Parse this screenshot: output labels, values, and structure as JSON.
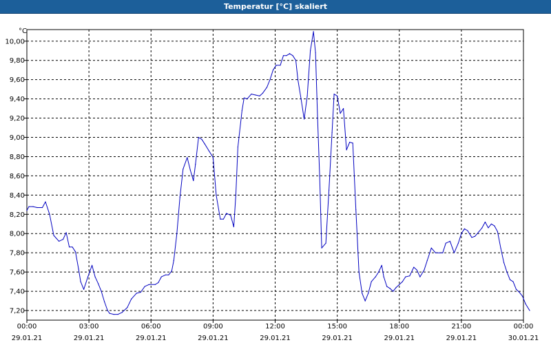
{
  "window": {
    "title": "Temperatur [°C] skaliert"
  },
  "chart_data": {
    "type": "line",
    "unit_label": "°C",
    "ylim": [
      7.1,
      10.12
    ],
    "xlim": [
      "29.01.21 00:00",
      "30.01.21 00:00"
    ],
    "grid": true,
    "y_ticks": [
      "10,00",
      "9,80",
      "9,60",
      "9,40",
      "9,20",
      "9,00",
      "8,80",
      "8,60",
      "8,40",
      "8,20",
      "8,00",
      "7,80",
      "7,60",
      "7,40",
      "7,20"
    ],
    "y_tick_values": [
      10.0,
      9.8,
      9.6,
      9.4,
      9.2,
      9.0,
      8.8,
      8.6,
      8.4,
      8.2,
      8.0,
      7.8,
      7.6,
      7.4,
      7.2
    ],
    "x_ticks": [
      {
        "time": "00:00",
        "date": "29.01.21",
        "hour": 0
      },
      {
        "time": "03:00",
        "date": "29.01.21",
        "hour": 3
      },
      {
        "time": "06:00",
        "date": "29.01.21",
        "hour": 6
      },
      {
        "time": "09:00",
        "date": "29.01.21",
        "hour": 9
      },
      {
        "time": "12:00",
        "date": "29.01.21",
        "hour": 12
      },
      {
        "time": "15:00",
        "date": "29.01.21",
        "hour": 15
      },
      {
        "time": "18:00",
        "date": "29.01.21",
        "hour": 18
      },
      {
        "time": "21:00",
        "date": "29.01.21",
        "hour": 21
      },
      {
        "time": "00:00",
        "date": "30.01.21",
        "hour": 24
      }
    ],
    "series": [
      {
        "color": "#0000c0",
        "points": [
          [
            0.0,
            8.24
          ],
          [
            0.1,
            8.28
          ],
          [
            0.3,
            8.28
          ],
          [
            0.5,
            8.27
          ],
          [
            0.75,
            8.27
          ],
          [
            0.9,
            8.33
          ],
          [
            1.1,
            8.2
          ],
          [
            1.3,
            7.98
          ],
          [
            1.55,
            7.92
          ],
          [
            1.75,
            7.94
          ],
          [
            1.9,
            8.01
          ],
          [
            2.05,
            7.86
          ],
          [
            2.2,
            7.86
          ],
          [
            2.35,
            7.81
          ],
          [
            2.5,
            7.63
          ],
          [
            2.6,
            7.5
          ],
          [
            2.75,
            7.42
          ],
          [
            2.95,
            7.55
          ],
          [
            3.15,
            7.67
          ],
          [
            3.3,
            7.55
          ],
          [
            3.45,
            7.48
          ],
          [
            3.6,
            7.4
          ],
          [
            3.75,
            7.29
          ],
          [
            3.9,
            7.2
          ],
          [
            4.0,
            7.17
          ],
          [
            4.2,
            7.16
          ],
          [
            4.4,
            7.16
          ],
          [
            4.6,
            7.18
          ],
          [
            4.85,
            7.23
          ],
          [
            5.05,
            7.32
          ],
          [
            5.3,
            7.38
          ],
          [
            5.5,
            7.39
          ],
          [
            5.7,
            7.45
          ],
          [
            5.9,
            7.47
          ],
          [
            6.2,
            7.47
          ],
          [
            6.35,
            7.49
          ],
          [
            6.5,
            7.55
          ],
          [
            6.7,
            7.57
          ],
          [
            6.85,
            7.57
          ],
          [
            7.0,
            7.61
          ],
          [
            7.1,
            7.72
          ],
          [
            7.25,
            8.0
          ],
          [
            7.4,
            8.38
          ],
          [
            7.55,
            8.67
          ],
          [
            7.75,
            8.79
          ],
          [
            7.9,
            8.66
          ],
          [
            8.05,
            8.55
          ],
          [
            8.15,
            8.72
          ],
          [
            8.3,
            9.0
          ],
          [
            8.45,
            8.98
          ],
          [
            8.6,
            8.93
          ],
          [
            8.8,
            8.86
          ],
          [
            9.0,
            8.79
          ],
          [
            9.15,
            8.4
          ],
          [
            9.35,
            8.15
          ],
          [
            9.5,
            8.15
          ],
          [
            9.65,
            8.21
          ],
          [
            9.85,
            8.19
          ],
          [
            10.0,
            8.07
          ],
          [
            10.1,
            8.4
          ],
          [
            10.2,
            8.9
          ],
          [
            10.4,
            9.28
          ],
          [
            10.5,
            9.41
          ],
          [
            10.65,
            9.4
          ],
          [
            10.85,
            9.45
          ],
          [
            11.05,
            9.44
          ],
          [
            11.25,
            9.43
          ],
          [
            11.4,
            9.46
          ],
          [
            11.6,
            9.52
          ],
          [
            11.75,
            9.6
          ],
          [
            11.9,
            9.7
          ],
          [
            12.05,
            9.75
          ],
          [
            12.25,
            9.75
          ],
          [
            12.4,
            9.85
          ],
          [
            12.55,
            9.85
          ],
          [
            12.7,
            9.87
          ],
          [
            12.85,
            9.85
          ],
          [
            13.0,
            9.8
          ],
          [
            13.1,
            9.6
          ],
          [
            13.25,
            9.4
          ],
          [
            13.4,
            9.19
          ],
          [
            13.55,
            9.43
          ],
          [
            13.7,
            9.9
          ],
          [
            13.85,
            10.1
          ],
          [
            13.95,
            9.88
          ],
          [
            14.05,
            9.2
          ],
          [
            14.15,
            8.6
          ],
          [
            14.25,
            7.85
          ],
          [
            14.45,
            7.9
          ],
          [
            14.6,
            8.45
          ],
          [
            14.75,
            9.05
          ],
          [
            14.85,
            9.45
          ],
          [
            15.0,
            9.43
          ],
          [
            15.15,
            9.25
          ],
          [
            15.3,
            9.3
          ],
          [
            15.45,
            8.87
          ],
          [
            15.6,
            8.95
          ],
          [
            15.75,
            8.94
          ],
          [
            15.9,
            8.25
          ],
          [
            16.05,
            7.6
          ],
          [
            16.2,
            7.38
          ],
          [
            16.35,
            7.3
          ],
          [
            16.5,
            7.38
          ],
          [
            16.65,
            7.5
          ],
          [
            16.85,
            7.55
          ],
          [
            17.0,
            7.6
          ],
          [
            17.15,
            7.67
          ],
          [
            17.25,
            7.55
          ],
          [
            17.4,
            7.45
          ],
          [
            17.55,
            7.43
          ],
          [
            17.7,
            7.4
          ],
          [
            17.85,
            7.44
          ],
          [
            18.0,
            7.47
          ],
          [
            18.15,
            7.5
          ],
          [
            18.3,
            7.55
          ],
          [
            18.5,
            7.56
          ],
          [
            18.7,
            7.65
          ],
          [
            18.85,
            7.62
          ],
          [
            19.0,
            7.55
          ],
          [
            19.2,
            7.62
          ],
          [
            19.35,
            7.72
          ],
          [
            19.55,
            7.85
          ],
          [
            19.75,
            7.8
          ],
          [
            19.95,
            7.8
          ],
          [
            20.1,
            7.8
          ],
          [
            20.25,
            7.9
          ],
          [
            20.45,
            7.92
          ],
          [
            20.65,
            7.8
          ],
          [
            20.85,
            7.9
          ],
          [
            21.0,
            8.0
          ],
          [
            21.15,
            8.05
          ],
          [
            21.3,
            8.03
          ],
          [
            21.5,
            7.96
          ],
          [
            21.65,
            7.97
          ],
          [
            21.85,
            8.02
          ],
          [
            22.0,
            8.06
          ],
          [
            22.15,
            8.12
          ],
          [
            22.3,
            8.06
          ],
          [
            22.45,
            8.1
          ],
          [
            22.6,
            8.08
          ],
          [
            22.75,
            8.02
          ],
          [
            22.9,
            7.85
          ],
          [
            23.05,
            7.7
          ],
          [
            23.2,
            7.6
          ],
          [
            23.35,
            7.52
          ],
          [
            23.5,
            7.5
          ],
          [
            23.65,
            7.42
          ],
          [
            23.8,
            7.39
          ],
          [
            23.95,
            7.35
          ],
          [
            24.1,
            7.27
          ],
          [
            24.3,
            7.2
          ]
        ]
      }
    ]
  }
}
